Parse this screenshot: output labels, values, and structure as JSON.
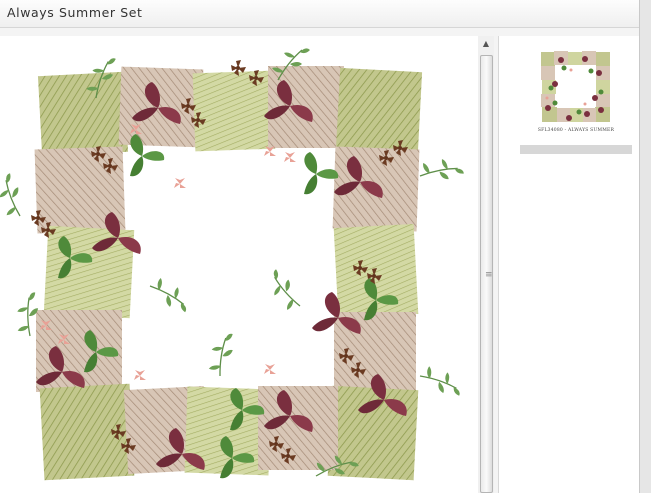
{
  "window": {
    "title": "Always Summer Set"
  },
  "thumbnail": {
    "caption": "SFL34080 - ALWAYS SUMMER"
  },
  "colors": {
    "moss": "#b6bd80",
    "sand": "#cdb8a4",
    "rose": "#e59a8f",
    "plum": "#7a2f3f",
    "leaf": "#4f8a3a",
    "brown": "#6b3b22"
  },
  "icons": {
    "scroll_up": "triangle-up-icon",
    "scroll_grip": "grip-icon"
  }
}
